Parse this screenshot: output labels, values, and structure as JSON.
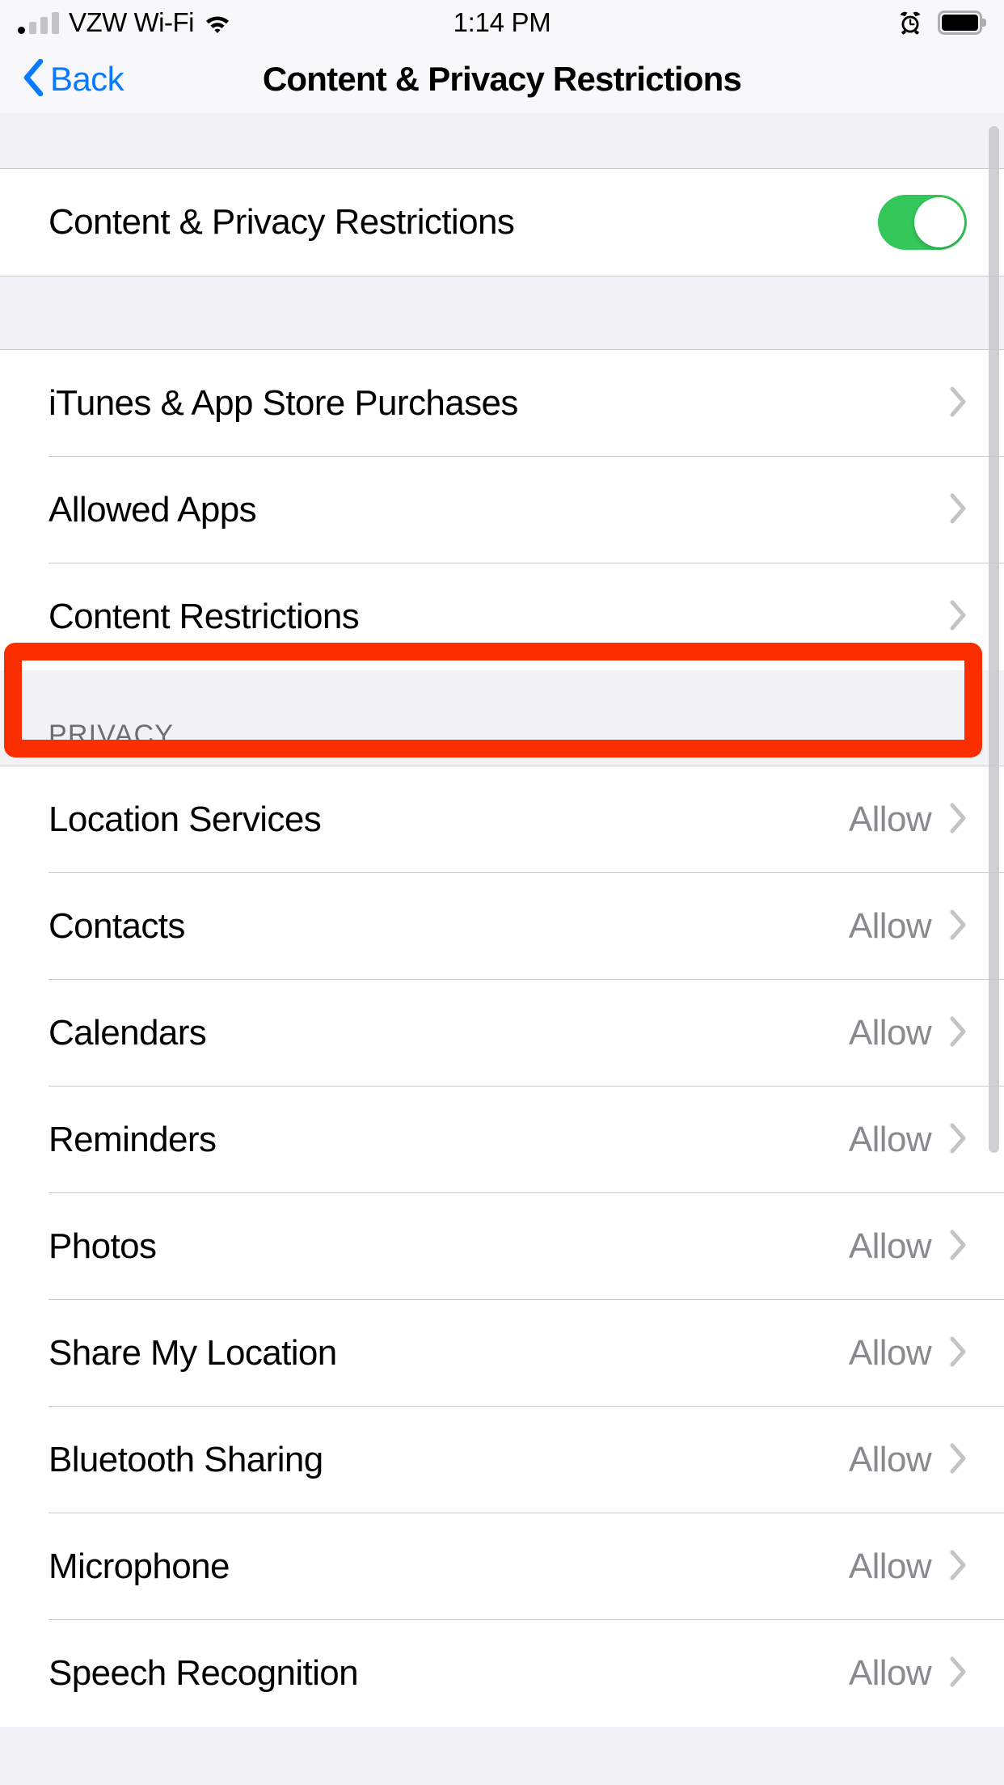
{
  "status_bar": {
    "carrier": "VZW Wi-Fi",
    "time": "1:14 PM",
    "signal_icon": "signal-bars-icon",
    "wifi_icon": "wifi-icon",
    "alarm_icon": "alarm-clock-icon",
    "battery_icon": "battery-full-icon"
  },
  "nav": {
    "back_label": "Back",
    "back_icon": "chevron-left-icon",
    "title": "Content & Privacy Restrictions"
  },
  "master_toggle": {
    "label": "Content & Privacy Restrictions",
    "state": "on",
    "on_color": "#34C759"
  },
  "restrictions_group": [
    {
      "label": "iTunes & App Store Purchases",
      "value": "",
      "accessory": "chevron-right-icon"
    },
    {
      "label": "Allowed Apps",
      "value": "",
      "accessory": "chevron-right-icon"
    },
    {
      "label": "Content Restrictions",
      "value": "",
      "accessory": "chevron-right-icon",
      "highlighted": true
    }
  ],
  "privacy_section": {
    "header": "PRIVACY",
    "rows": [
      {
        "label": "Location Services",
        "value": "Allow",
        "accessory": "chevron-right-icon"
      },
      {
        "label": "Contacts",
        "value": "Allow",
        "accessory": "chevron-right-icon"
      },
      {
        "label": "Calendars",
        "value": "Allow",
        "accessory": "chevron-right-icon"
      },
      {
        "label": "Reminders",
        "value": "Allow",
        "accessory": "chevron-right-icon"
      },
      {
        "label": "Photos",
        "value": "Allow",
        "accessory": "chevron-right-icon"
      },
      {
        "label": "Share My Location",
        "value": "Allow",
        "accessory": "chevron-right-icon"
      },
      {
        "label": "Bluetooth Sharing",
        "value": "Allow",
        "accessory": "chevron-right-icon"
      },
      {
        "label": "Microphone",
        "value": "Allow",
        "accessory": "chevron-right-icon"
      },
      {
        "label": "Speech Recognition",
        "value": "Allow",
        "accessory": "chevron-right-icon"
      }
    ]
  },
  "annotation": {
    "target": "Content Restrictions",
    "color": "#FB2E00"
  },
  "colors": {
    "accent_blue": "#0A7AFF",
    "group_bg": "#FFFFFF",
    "page_bg": "#F2F1F6",
    "separator": "#C9C9CC",
    "secondary_text": "#8A8A8E"
  }
}
